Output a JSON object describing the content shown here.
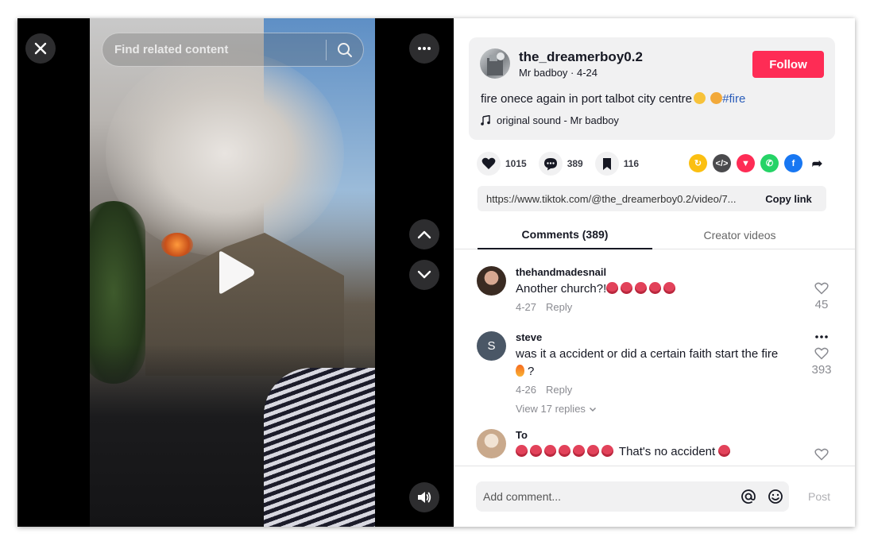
{
  "video": {
    "search_placeholder": "Find related content"
  },
  "post": {
    "author_username": "the_dreamerboy0.2",
    "author_display": "Mr badboy · 4-24",
    "follow_label": "Follow",
    "caption_text": "fire onece again in port talbot city centre",
    "caption_tag": "#fire",
    "sound_label": "original sound - Mr badboy",
    "likes": "1015",
    "comments_count": "389",
    "saves": "116",
    "link_url": "https://www.tiktok.com/@the_dreamerboy0.2/video/7...",
    "copy_link_label": "Copy link"
  },
  "tabs": {
    "comments_label": "Comments (389)",
    "creator_label": "Creator videos"
  },
  "comments": [
    {
      "user": "thehandmadesnail",
      "text": "Another church?!",
      "date": "4-27",
      "reply": "Reply",
      "likes": "45"
    },
    {
      "user": "steve",
      "avatar_letter": "S",
      "text": "was it a accident or did a certain faith start the fire",
      "text_end": "?",
      "date": "4-26",
      "reply": "Reply",
      "likes": "393",
      "view_replies": "View 17 replies"
    },
    {
      "user": "To",
      "text": "That's no accident"
    }
  ],
  "composer": {
    "placeholder": "Add comment...",
    "post_label": "Post"
  },
  "colors": {
    "follow": "#fe2c55",
    "hashtag": "#2b5db9"
  }
}
